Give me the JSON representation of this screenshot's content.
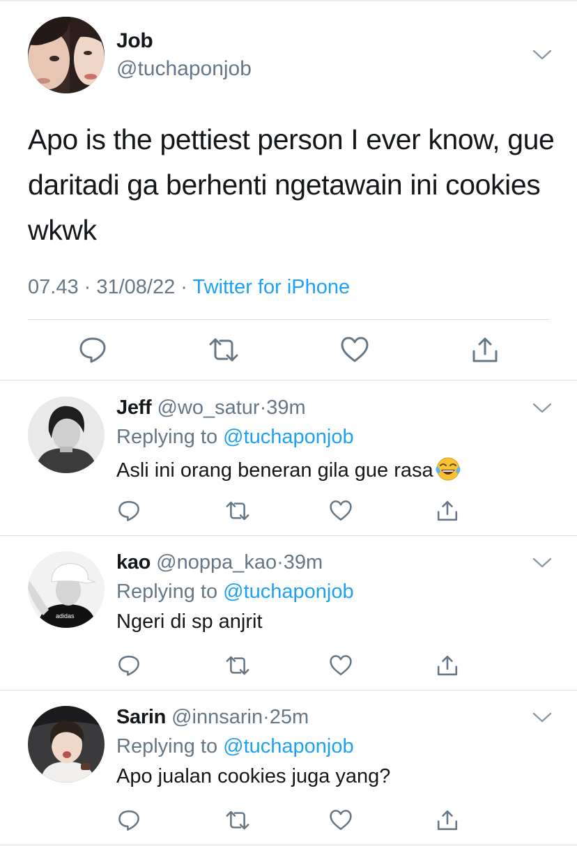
{
  "main_tweet": {
    "name": "Job",
    "handle": "@tuchaponjob",
    "text": "Apo is the pettiest person I ever know, gue daritadi ga berhenti ngetawain ini cookies wkwk",
    "time": "07.43",
    "sep1": " · ",
    "date": "31/08/22",
    "sep2": " · ",
    "source": "Twitter for iPhone"
  },
  "replies": [
    {
      "name": "Jeff",
      "handle": "@wo_satur",
      "dot": "·",
      "time": "39m",
      "replying_prefix": "Replying to ",
      "replying_handle": "@tuchaponjob",
      "text": "Asli ini orang beneran gila gue rasa",
      "emoji": "face-with-tears-of-joy"
    },
    {
      "name": "kao",
      "handle": "@noppa_kao",
      "dot": "·",
      "time": "39m",
      "replying_prefix": "Replying to ",
      "replying_handle": "@tuchaponjob",
      "text": "Ngeri di sp anjrit"
    },
    {
      "name": "Sarin",
      "handle": "@innsarin",
      "dot": "·",
      "time": "25m",
      "replying_prefix": "Replying to ",
      "replying_handle": "@tuchaponjob",
      "text": "Apo jualan cookies juga yang?"
    }
  ],
  "icons": [
    "chevron-down-icon",
    "reply-icon",
    "retweet-icon",
    "like-icon",
    "share-icon"
  ],
  "colors": {
    "link": "#1da1f2",
    "muted": "#657786",
    "icon": "#657786",
    "text": "#14171a",
    "divider": "#dcdfe2"
  }
}
